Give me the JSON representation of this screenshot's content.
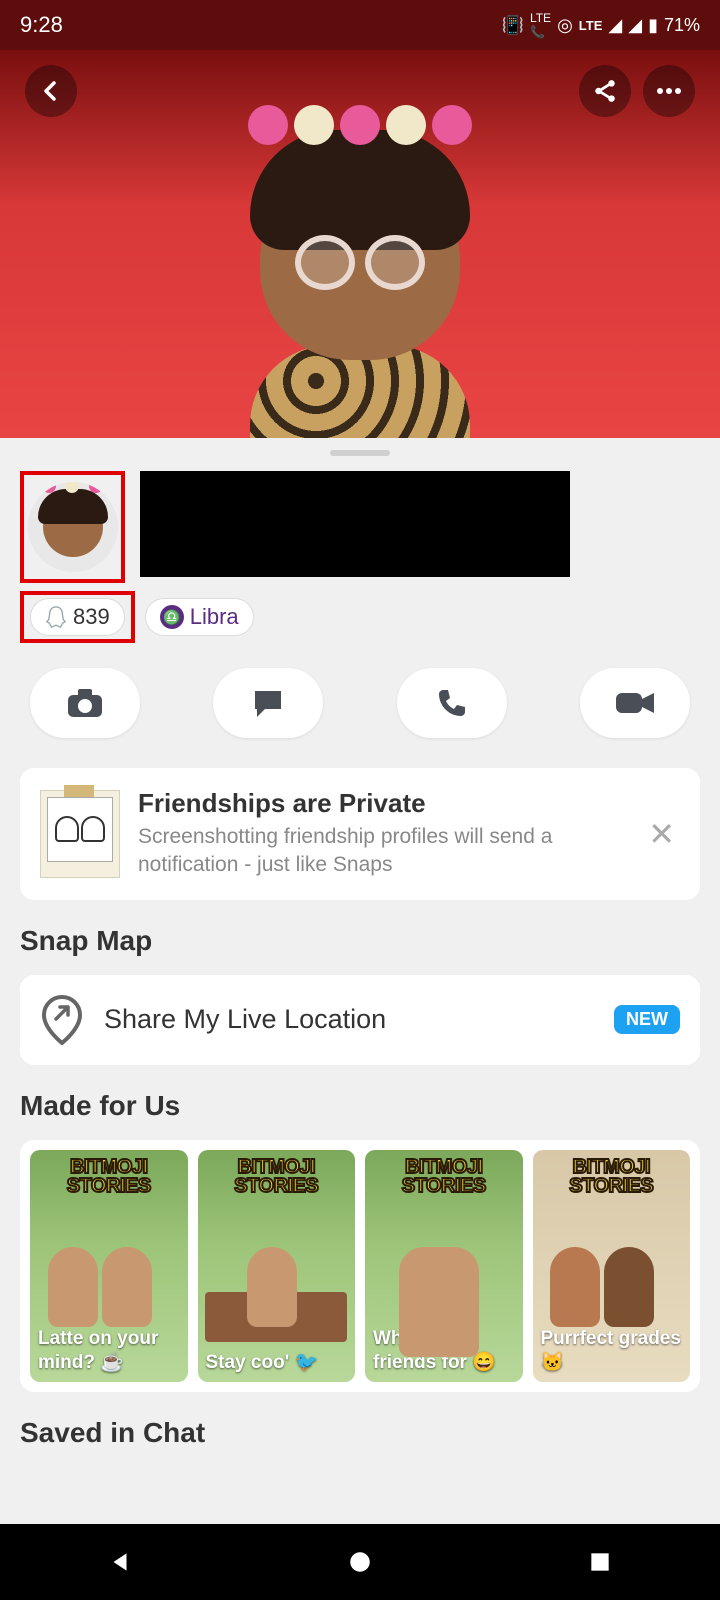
{
  "status": {
    "time": "9:28",
    "battery": "71%",
    "network_label": "LTE"
  },
  "badges": {
    "snap_score": "839",
    "zodiac": "Libra"
  },
  "actions": {
    "camera": "camera",
    "chat": "chat",
    "call": "call",
    "video": "video"
  },
  "privacy_card": {
    "title": "Friendships are Private",
    "subtitle": "Screenshotting friendship profiles will send a notification - just like Snaps"
  },
  "sections": {
    "snapmap_title": "Snap Map",
    "share_location": "Share My Live Location",
    "new_badge": "NEW",
    "made_for_us": "Made for Us",
    "saved_in_chat": "Saved in Chat"
  },
  "stories_logo": "BITMOJI STORIES",
  "stories": [
    {
      "caption": "Latte on your mind? ☕"
    },
    {
      "caption": "Stay coo' 🐦"
    },
    {
      "caption": "What are friends for 😄"
    },
    {
      "caption": "Purrfect grades 🐱"
    }
  ]
}
